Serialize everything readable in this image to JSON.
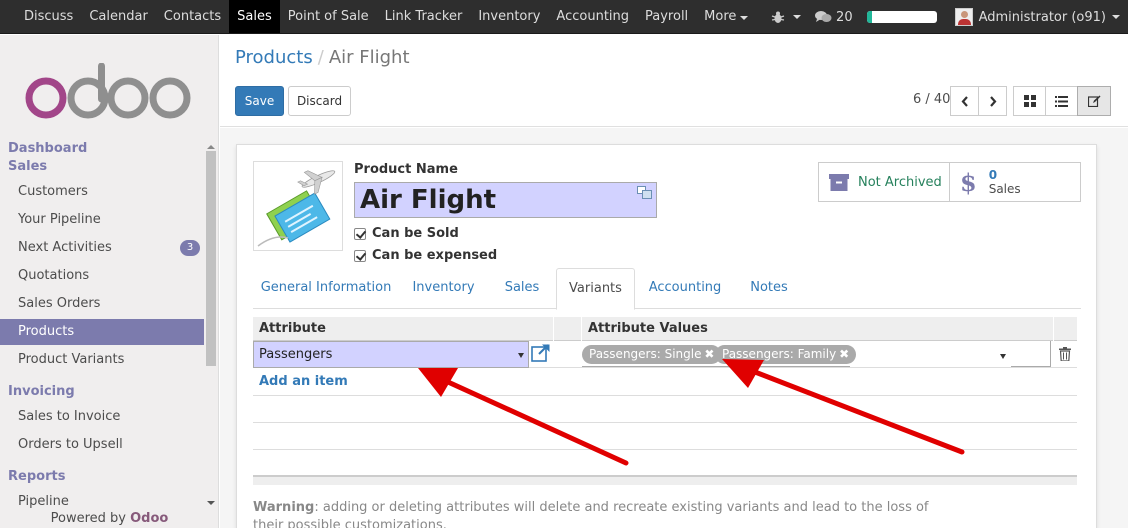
{
  "topbar": {
    "menu": [
      {
        "label": "Discuss",
        "active": false
      },
      {
        "label": "Calendar",
        "active": false
      },
      {
        "label": "Contacts",
        "active": false
      },
      {
        "label": "Sales",
        "active": true
      },
      {
        "label": "Point of Sale",
        "active": false
      },
      {
        "label": "Link Tracker",
        "active": false
      },
      {
        "label": "Inventory",
        "active": false
      },
      {
        "label": "Accounting",
        "active": false
      },
      {
        "label": "Payroll",
        "active": false
      },
      {
        "label": "More",
        "active": false
      }
    ],
    "debug_icon": "bug-icon",
    "messages_count": "20",
    "progress_fraction": 0.08,
    "user": "Administrator (o91)"
  },
  "sidebar": {
    "logo_text": "odoo",
    "sections": [
      {
        "label": "Dashboard"
      },
      {
        "label": "Sales"
      },
      {
        "label": "Invoicing"
      },
      {
        "label": "Reports"
      }
    ],
    "items": [
      {
        "label": "Customers"
      },
      {
        "label": "Your Pipeline"
      },
      {
        "label": "Next Activities",
        "badge": "3"
      },
      {
        "label": "Quotations"
      },
      {
        "label": "Sales Orders"
      },
      {
        "label": "Products",
        "active": true
      },
      {
        "label": "Product Variants"
      },
      {
        "label": "Sales to Invoice"
      },
      {
        "label": "Orders to Upsell"
      },
      {
        "label": "Pipeline"
      }
    ],
    "powered_prefix": "Powered by ",
    "powered_brand": "Odoo"
  },
  "control_panel": {
    "breadcrumb_parent": "Products",
    "breadcrumb_sep": "/",
    "breadcrumb_current": "Air Flight",
    "save_label": "Save",
    "discard_label": "Discard",
    "pager": "6 / 40"
  },
  "form": {
    "product_name_label": "Product Name",
    "product_name": "Air Flight",
    "can_be_sold_label": "Can be Sold",
    "can_be_expensed_label": "Can be expensed",
    "stat_archive_label": "Not Archived",
    "stat_sales_count": "0",
    "stat_sales_label": "Sales",
    "tabs": [
      {
        "label": "General Information"
      },
      {
        "label": "Inventory"
      },
      {
        "label": "Sales"
      },
      {
        "label": "Variants",
        "active": true
      },
      {
        "label": "Accounting"
      },
      {
        "label": "Notes"
      }
    ],
    "variants_table": {
      "col_attribute": "Attribute",
      "col_values": "Attribute Values",
      "row_attribute": "Passengers",
      "values": [
        "Passengers: Single",
        "Passengers: Family"
      ],
      "add_item_label": "Add an item"
    },
    "warning_title": "Warning",
    "warning_text": ": adding or deleting attributes will delete and recreate existing variants and lead to the loss of their possible customizations."
  },
  "colors": {
    "brand": "#7c7bad",
    "primary": "#337ab7",
    "required_field": "#d2d2ff",
    "archive_green": "#26815c",
    "annotation_red": "#e00000"
  }
}
